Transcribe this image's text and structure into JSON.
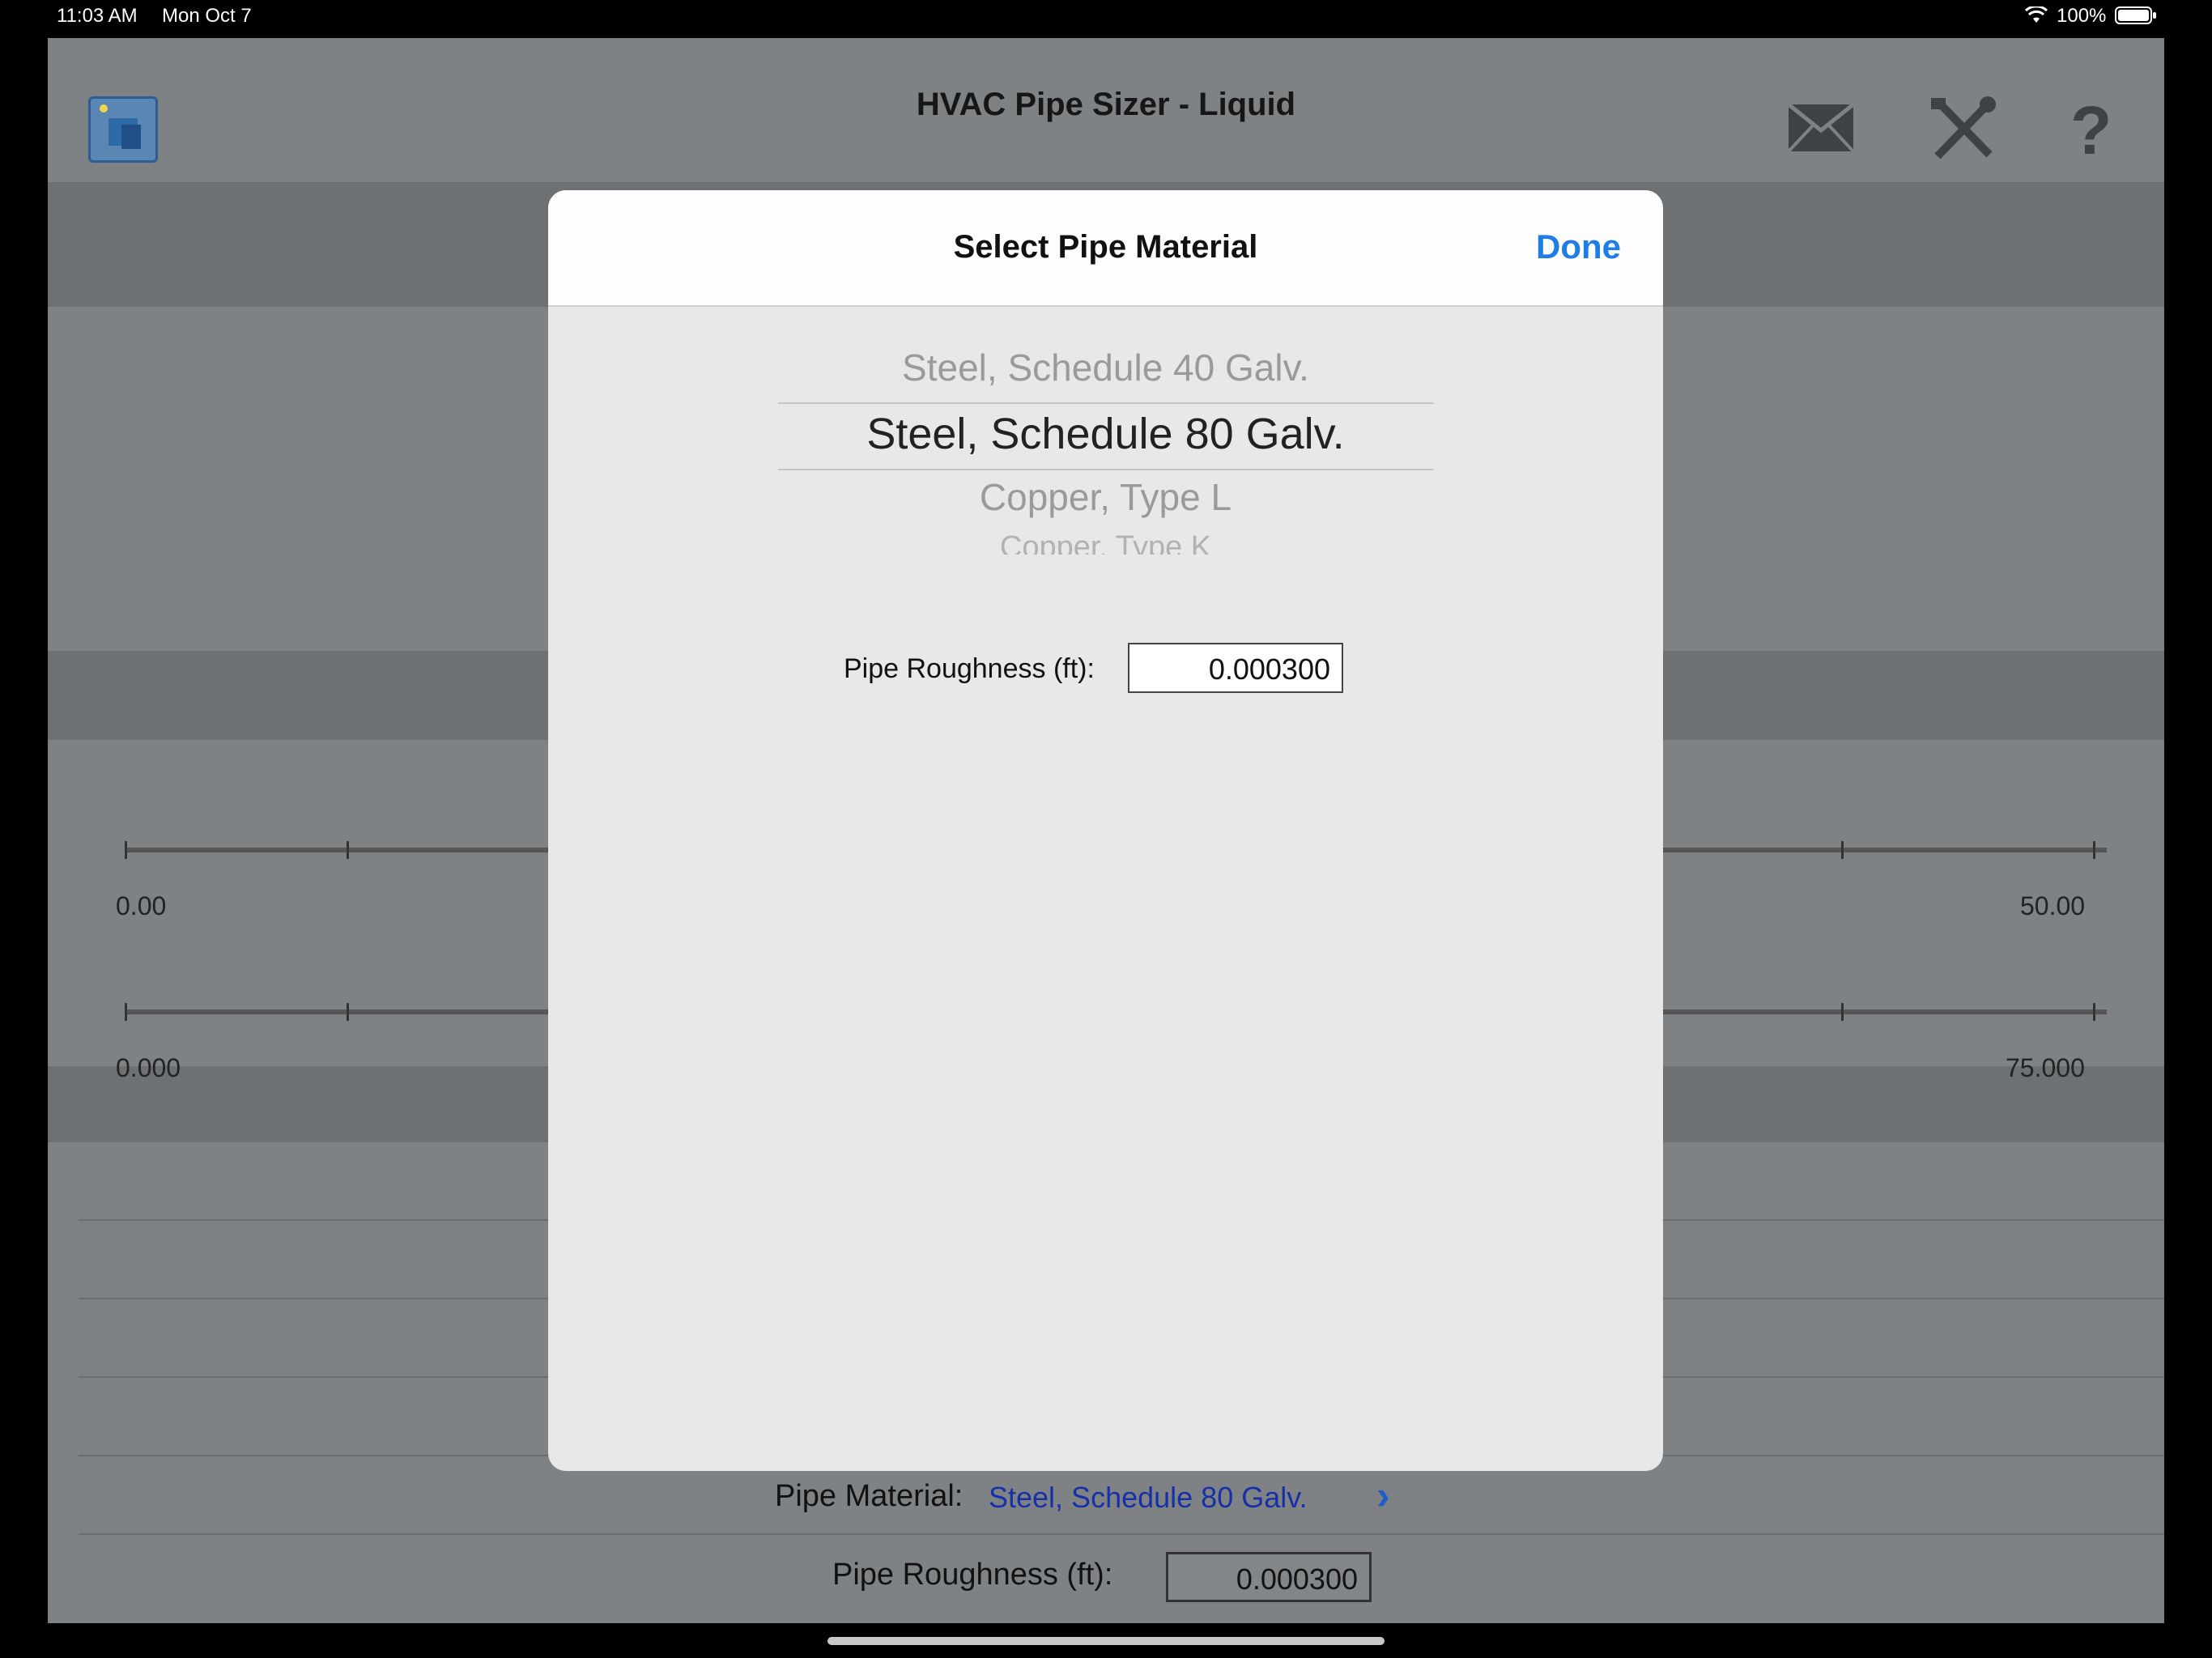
{
  "status_bar": {
    "time": "11:03 AM",
    "date": "Mon Oct 7",
    "battery": "100%"
  },
  "app": {
    "title": "HVAC Pipe Sizer - Liquid",
    "icons": [
      "app-logo-icon",
      "mail-icon",
      "tools-icon",
      "help-icon"
    ],
    "scales": [
      {
        "min_label": "0.00",
        "max_label": "50.00"
      },
      {
        "min_label": "0.000",
        "max_label": "75.000"
      }
    ],
    "bottom": {
      "material_label": "Pipe Material:",
      "material_value": "Steel, Schedule 80 Galv.",
      "roughness_label": "Pipe Roughness (ft):",
      "roughness_value": "0.000300"
    }
  },
  "modal": {
    "title": "Select Pipe Material",
    "done_label": "Done",
    "picker": {
      "options_visible": [
        "Steel, Schedule 40 Galv.",
        "Steel, Schedule 80 Galv.",
        "Copper, Type L",
        "Copper, Type K"
      ],
      "selected": "Steel, Schedule 80 Galv."
    },
    "roughness_label": "Pipe Roughness (ft):",
    "roughness_value": "0.000300"
  },
  "colors": {
    "accent": "#1f7ee6",
    "link_blue": "#1730a8",
    "dim_overlay": "#7f8285"
  }
}
